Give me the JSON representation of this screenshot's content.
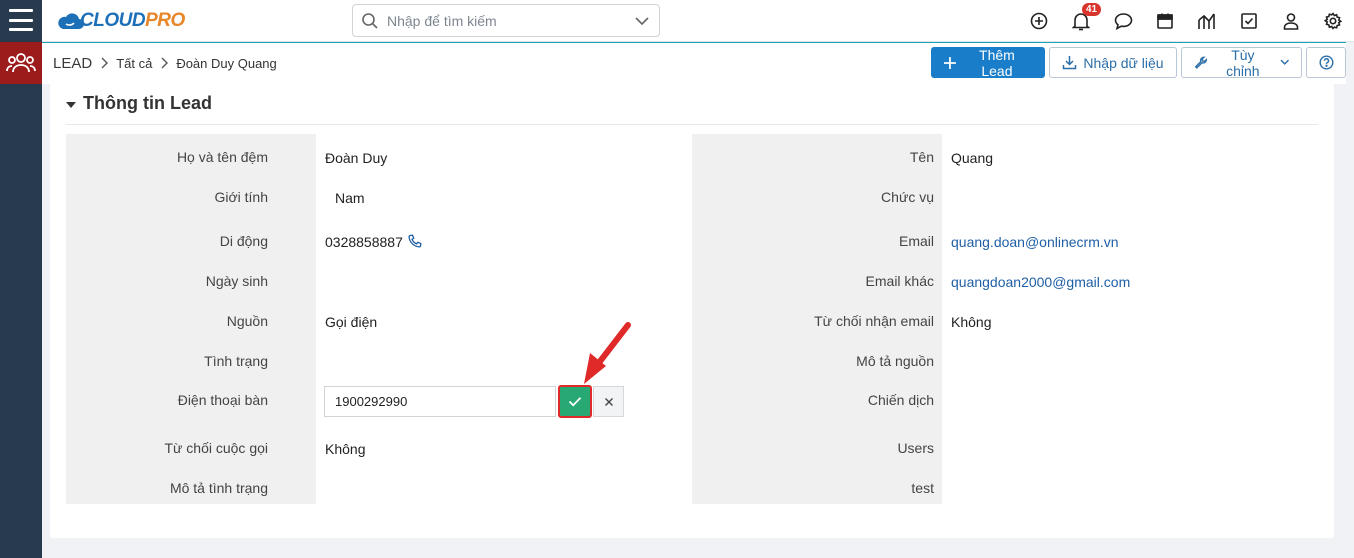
{
  "search": {
    "placeholder": "Nhập để tìm kiếm"
  },
  "logo": {
    "brand_a": "CLOUD",
    "brand_b": "PRO"
  },
  "topbar": {
    "icons": [
      "add-icon",
      "bell-icon",
      "chat-icon",
      "calendar-icon",
      "report-icon",
      "task-icon",
      "user-icon",
      "gear-icon"
    ],
    "notification_count": "41"
  },
  "breadcrumb": {
    "module": "LEAD",
    "filter": "Tất cả",
    "record": "Đoàn Duy Quang"
  },
  "actions": {
    "add_label": "Thêm Lead",
    "import_label": "Nhập dữ liệu",
    "customize_label": "Tùy chỉnh"
  },
  "section": {
    "title": "Thông tin Lead"
  },
  "fields_left": [
    {
      "label": "Họ và tên đệm",
      "value": "Đoàn Duy"
    },
    {
      "label": "Giới tính",
      "value": "Nam"
    },
    {
      "label": "Di động",
      "value": "0328858887"
    },
    {
      "label": "Ngày sinh",
      "value": ""
    },
    {
      "label": "Nguồn",
      "value": "Gọi điện"
    },
    {
      "label": "Tình trạng",
      "value": ""
    },
    {
      "label": "Điện thoại bàn",
      "value": "1900292990"
    },
    {
      "label": "Từ chối cuộc gọi",
      "value": "Không"
    },
    {
      "label": "Mô tả tình trạng",
      "value": ""
    }
  ],
  "fields_right": [
    {
      "label": "Tên",
      "value": "Quang"
    },
    {
      "label": "Chức vụ",
      "value": ""
    },
    {
      "label": "Email",
      "value": "quang.doan@onlinecrm.vn"
    },
    {
      "label": "Email khác",
      "value": "quangdoan2000@gmail.com"
    },
    {
      "label": "Từ chối nhận email",
      "value": "Không"
    },
    {
      "label": "Mô tả nguồn",
      "value": ""
    },
    {
      "label": "Chiến dịch",
      "value": ""
    },
    {
      "label": "Users",
      "value": ""
    },
    {
      "label": "test",
      "value": ""
    }
  ],
  "colors": {
    "primary": "#1a7dc9",
    "success": "#28a873",
    "highlight": "#e02a2a",
    "rail": "#283a4d",
    "module": "#9c1b1b"
  }
}
